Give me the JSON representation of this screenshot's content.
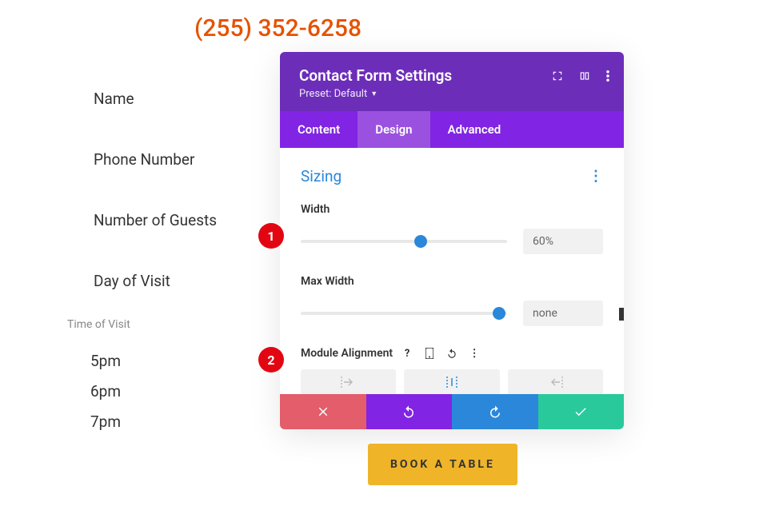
{
  "page": {
    "phone": "(255) 352-6258",
    "book_label": "BOOK A TABLE"
  },
  "form": {
    "name": "Name",
    "phone": "Phone Number",
    "guests": "Number of Guests",
    "day": "Day of Visit",
    "time_section": "Time of Visit",
    "times": [
      "5pm",
      "6pm",
      "7pm"
    ]
  },
  "modal": {
    "title": "Contact Form Settings",
    "preset": "Preset: Default",
    "tabs": {
      "content": "Content",
      "design": "Design",
      "advanced": "Advanced"
    },
    "panel_title": "Sizing",
    "width": {
      "label": "Width",
      "value": "60%",
      "thumb_pct": 58
    },
    "max_width": {
      "label": "Max Width",
      "value": "none",
      "thumb_pct": 96
    },
    "alignment": {
      "label": "Module Alignment",
      "selected": "center"
    }
  },
  "callouts": {
    "one": "1",
    "two": "2"
  }
}
